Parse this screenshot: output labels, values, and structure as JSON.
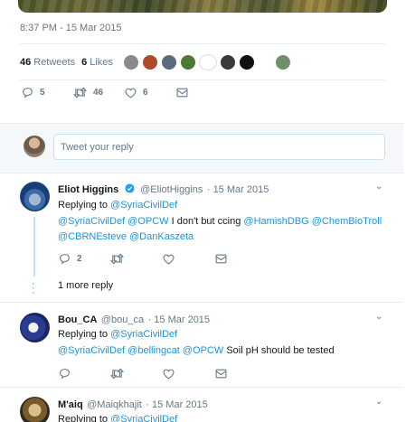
{
  "main_tweet": {
    "timestamp": "8:37 PM - 15 Mar 2015",
    "retweets_count": "46",
    "retweets_label": "Retweets",
    "likes_count": "6",
    "likes_label": "Likes",
    "liker_avatar_colors": [
      "#8a8a8a",
      "#b04a2a",
      "#5a6b7d",
      "#4b7a35",
      "#ffffff",
      "#3a3a3a",
      "#111111",
      "#6f8f6a"
    ],
    "actions": {
      "reply_count": "5",
      "retweet_count": "46",
      "like_count": "6"
    }
  },
  "reply_box": {
    "placeholder": "Tweet your reply"
  },
  "replies": [
    {
      "name": "Eliot Higgins",
      "verified": true,
      "handle": "@EliotHiggins",
      "date": "· 15 Mar 2015",
      "replying_prefix": "Replying to",
      "replying_to": "@SyriaCivilDef",
      "line1_mentions": "@SyriaCivilDef @OPCW",
      "line1_text": "I don't but ccing",
      "line1_mentions_end": "@HamishDBG @ChemBioTroll",
      "line2_mentions": "@CBRNEsteve @DanKaszeta",
      "reply_count": "2",
      "more_replies": "1 more reply"
    },
    {
      "name": "Bou_CA",
      "handle": "@bou_ca",
      "date": "· 15 Mar 2015",
      "replying_prefix": "Replying to",
      "replying_to": "@SyriaCivilDef",
      "mentions": "@SyriaCivilDef @bellingcat @OPCW",
      "text": "Soil pH should be tested"
    },
    {
      "name": "M'aiq",
      "handle": "@Maiqkhajit",
      "date": "· 15 Mar 2015",
      "replying_prefix": "Replying to",
      "replying_to": "@SyriaCivilDef"
    }
  ],
  "colors": {
    "link": "#1b95e0",
    "muted": "#657786",
    "divider": "#e6ecf0",
    "band": "#f5f8fa"
  }
}
